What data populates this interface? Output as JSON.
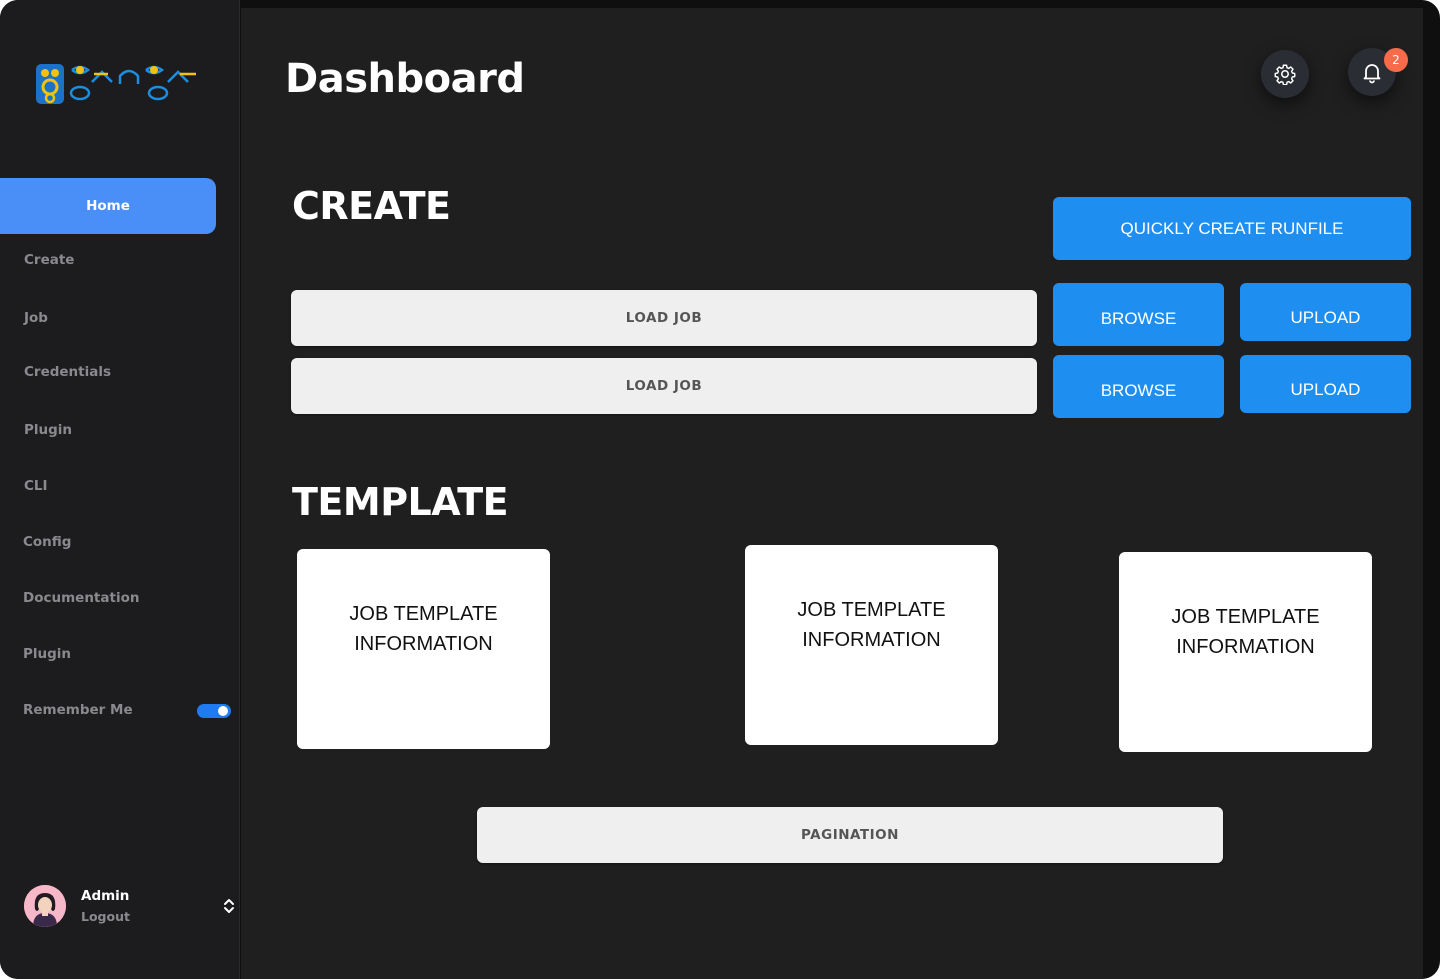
{
  "app": {
    "logo_text": "ganga"
  },
  "sidebar": {
    "items": [
      {
        "label": "Home",
        "active": true
      },
      {
        "label": "Create"
      },
      {
        "label": "Job"
      },
      {
        "label": "Credentials"
      },
      {
        "label": "Plugin"
      },
      {
        "label": "CLI"
      },
      {
        "label": "Config"
      },
      {
        "label": "Documentation"
      },
      {
        "label": "Plugin"
      }
    ],
    "remember_me": {
      "label": "Remember Me",
      "enabled": true
    },
    "user": {
      "name": "Admin",
      "logout_label": "Logout"
    }
  },
  "header": {
    "title": "Dashboard",
    "notification_count": "2"
  },
  "create_section": {
    "title": "CREATE",
    "quick_create_label": "QUICKLY CREATE RUNFILE",
    "rows": [
      {
        "load_label": "LOAD  JOB",
        "browse_label": "BROWSE",
        "upload_label": "UPLOAD"
      },
      {
        "load_label": "LOAD  JOB",
        "browse_label": "BROWSE",
        "upload_label": "UPLOAD"
      }
    ]
  },
  "template_section": {
    "title": "TEMPLATE",
    "cards": [
      {
        "label": "JOB TEMPLATE INFORMATION"
      },
      {
        "label": "JOB TEMPLATE INFORMATION"
      },
      {
        "label": "JOB TEMPLATE INFORMATION"
      }
    ],
    "pagination_label": "PAGINATION"
  },
  "colors": {
    "accent": "#4a8ff7",
    "button_blue": "#1e8ff0",
    "badge": "#f76b4b",
    "background": "#1f1f1f"
  },
  "icons": [
    "gear-icon",
    "bell-icon",
    "chevron-up-down-icon"
  ]
}
